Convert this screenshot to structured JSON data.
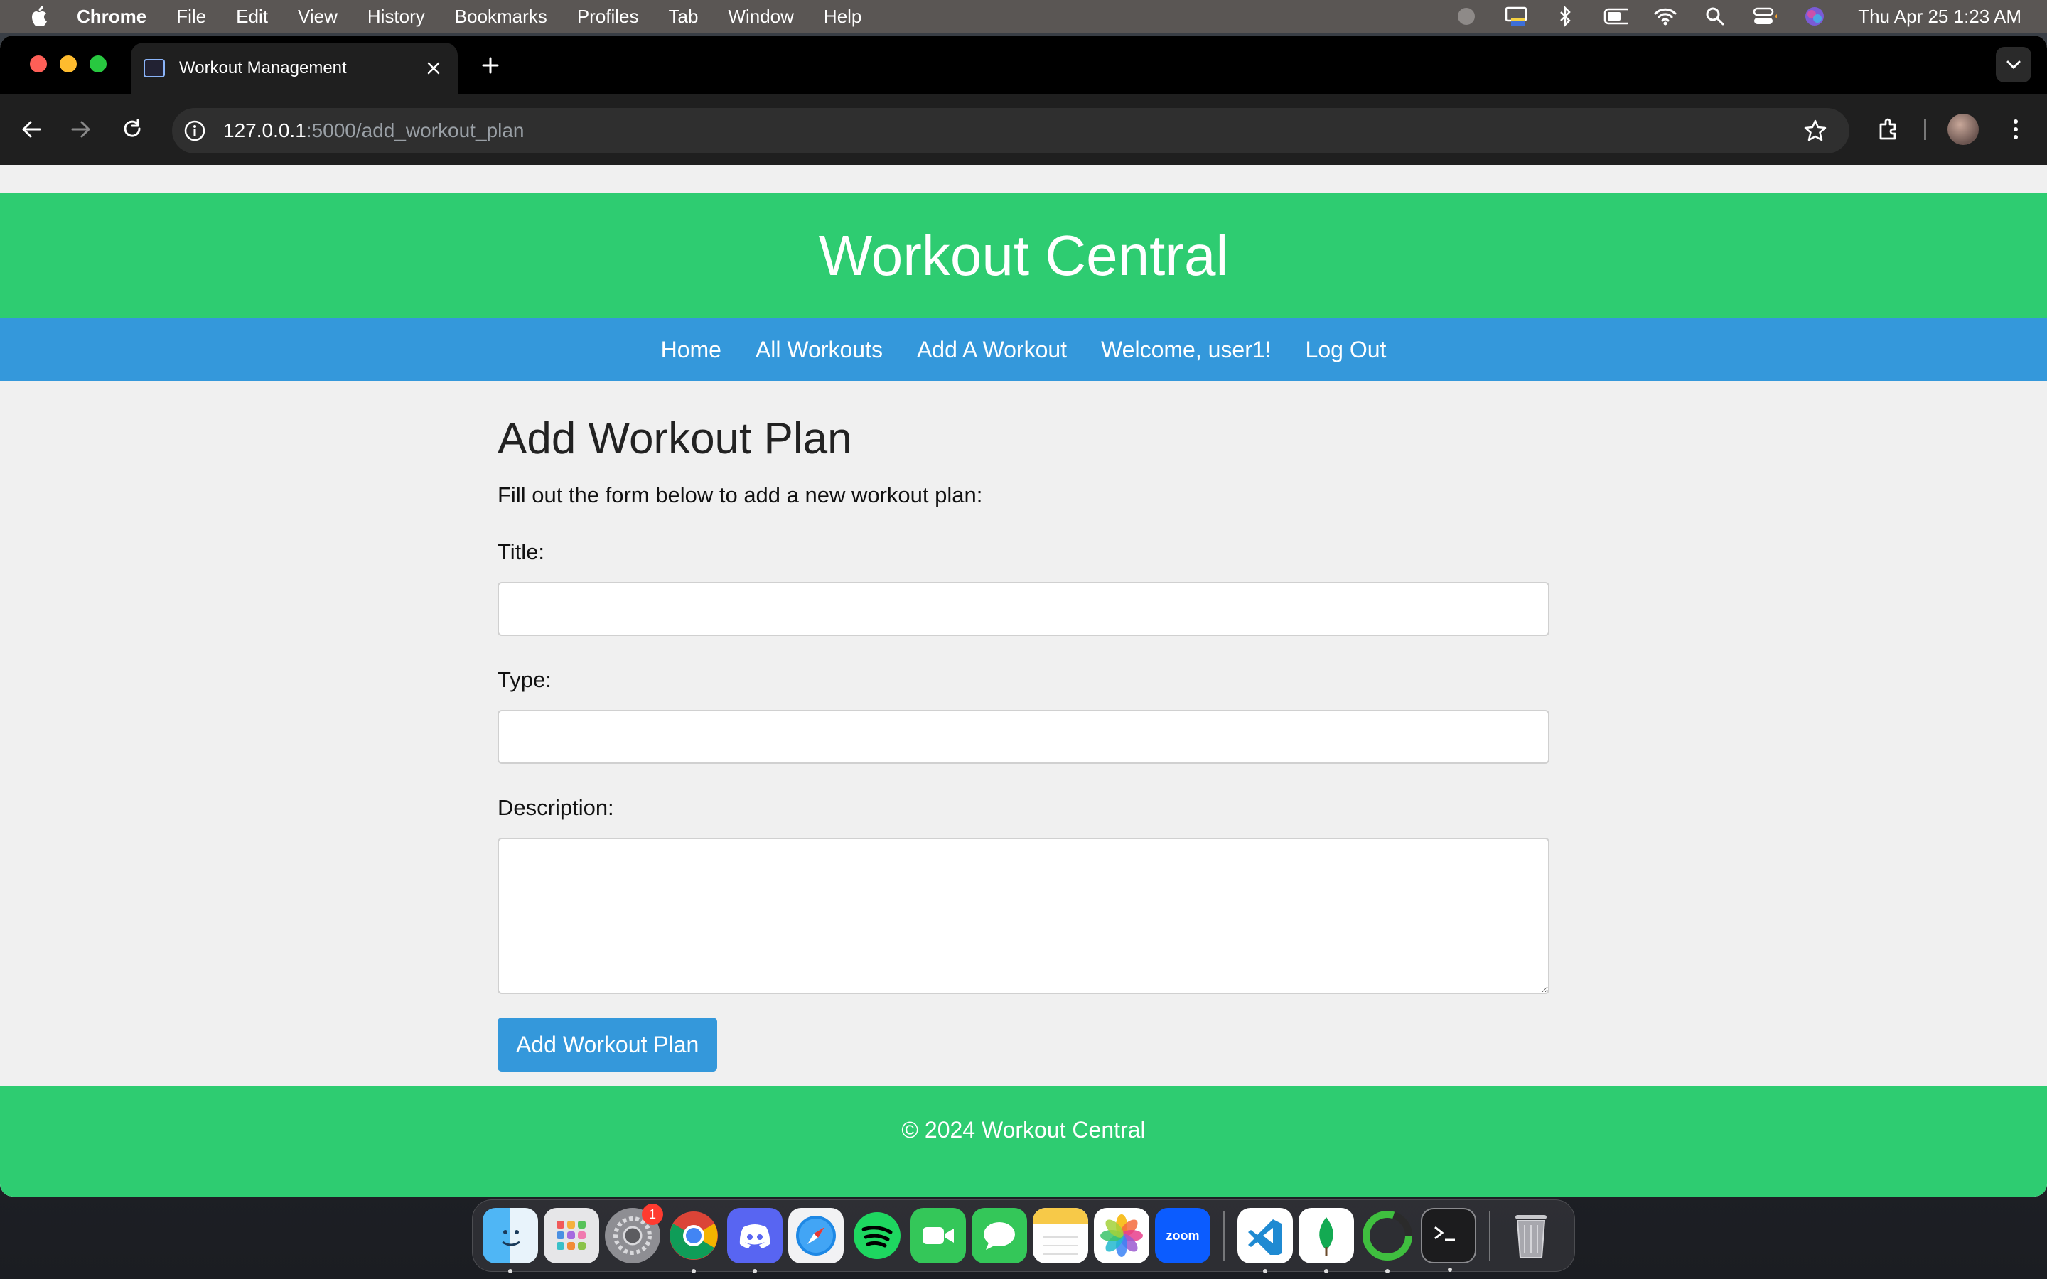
{
  "menubar": {
    "app_name": "Chrome",
    "items": [
      "File",
      "Edit",
      "View",
      "History",
      "Bookmarks",
      "Profiles",
      "Tab",
      "Window",
      "Help"
    ],
    "clock": "Thu Apr 25  1:23 AM"
  },
  "browser": {
    "tab_title": "Workout Management",
    "url_host": "127.0.0.1",
    "url_path": ":5000/add_workout_plan"
  },
  "site": {
    "title": "Workout Central",
    "nav": [
      "Home",
      "All Workouts",
      "Add A Workout",
      "Welcome, user1!",
      "Log Out"
    ],
    "footer": "© 2024 Workout Central"
  },
  "form": {
    "heading": "Add Workout Plan",
    "intro": "Fill out the form below to add a new workout plan:",
    "title_label": "Title:",
    "title_value": "",
    "type_label": "Type:",
    "type_value": "",
    "description_label": "Description:",
    "description_value": "",
    "submit_label": "Add Workout Plan"
  },
  "dock": {
    "apps": [
      "Finder",
      "Launchpad",
      "System Settings",
      "Chrome",
      "Discord",
      "Safari",
      "Spotify",
      "FaceTime",
      "Messages",
      "Notes",
      "Photos",
      "Zoom",
      "Visual Studio Code",
      "MongoDB Compass",
      "Loading",
      "Terminal",
      "Trash"
    ],
    "settings_badge": "1",
    "zoom_label": "zoom"
  },
  "colors": {
    "header_green": "#2ecc71",
    "nav_blue": "#3498db",
    "button_blue": "#3498db"
  }
}
